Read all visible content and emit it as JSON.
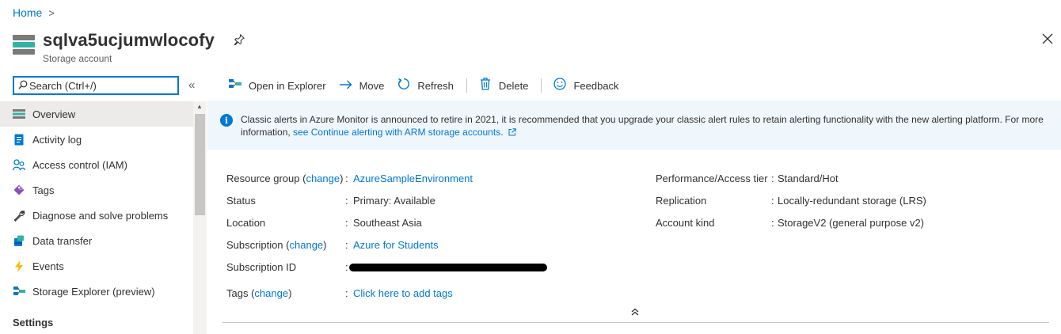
{
  "breadcrumb": {
    "home": "Home",
    "separator": ">"
  },
  "resource": {
    "name": "sqlva5ucjumwlocofy",
    "type": "Storage account"
  },
  "search": {
    "placeholder": "Search (Ctrl+/)"
  },
  "sidebar": {
    "items": [
      {
        "label": "Overview",
        "icon": "overview-icon"
      },
      {
        "label": "Activity log",
        "icon": "activity-log-icon"
      },
      {
        "label": "Access control (IAM)",
        "icon": "people-icon"
      },
      {
        "label": "Tags",
        "icon": "tag-icon"
      },
      {
        "label": "Diagnose and solve problems",
        "icon": "wrench-icon"
      },
      {
        "label": "Data transfer",
        "icon": "data-transfer-icon"
      },
      {
        "label": "Events",
        "icon": "lightning-icon"
      },
      {
        "label": "Storage Explorer (preview)",
        "icon": "storage-explorer-icon"
      }
    ],
    "section_settings": "Settings"
  },
  "toolbar": {
    "open_in_explorer": "Open in Explorer",
    "move": "Move",
    "refresh": "Refresh",
    "delete": "Delete",
    "feedback": "Feedback"
  },
  "banner": {
    "text": "Classic alerts in Azure Monitor is announced to retire in 2021, it is recommended that you upgrade your classic alert rules to retain alerting functionality with the new alerting platform. For more information,",
    "link": "see Continue alerting with ARM storage accounts."
  },
  "essentials": {
    "left": {
      "resource_group_label": "Resource group",
      "change": "change",
      "resource_group_value": "AzureSampleEnvironment",
      "status_label": "Status",
      "status_value": "Primary: Available",
      "location_label": "Location",
      "location_value": "Southeast Asia",
      "subscription_label": "Subscription",
      "subscription_value": "Azure for Students",
      "subscription_id_label": "Subscription ID",
      "tags_label": "Tags",
      "tags_value": "Click here to add tags"
    },
    "right": {
      "perf_label": "Performance/Access tier",
      "perf_value": "Standard/Hot",
      "replication_label": "Replication",
      "replication_value": "Locally-redundant storage (LRS)",
      "kind_label": "Account kind",
      "kind_value": "StorageV2 (general purpose v2)"
    }
  },
  "colors": {
    "accent": "#0078d4",
    "banner_bg": "#eff6fc",
    "active_nav": "#edebe9"
  }
}
